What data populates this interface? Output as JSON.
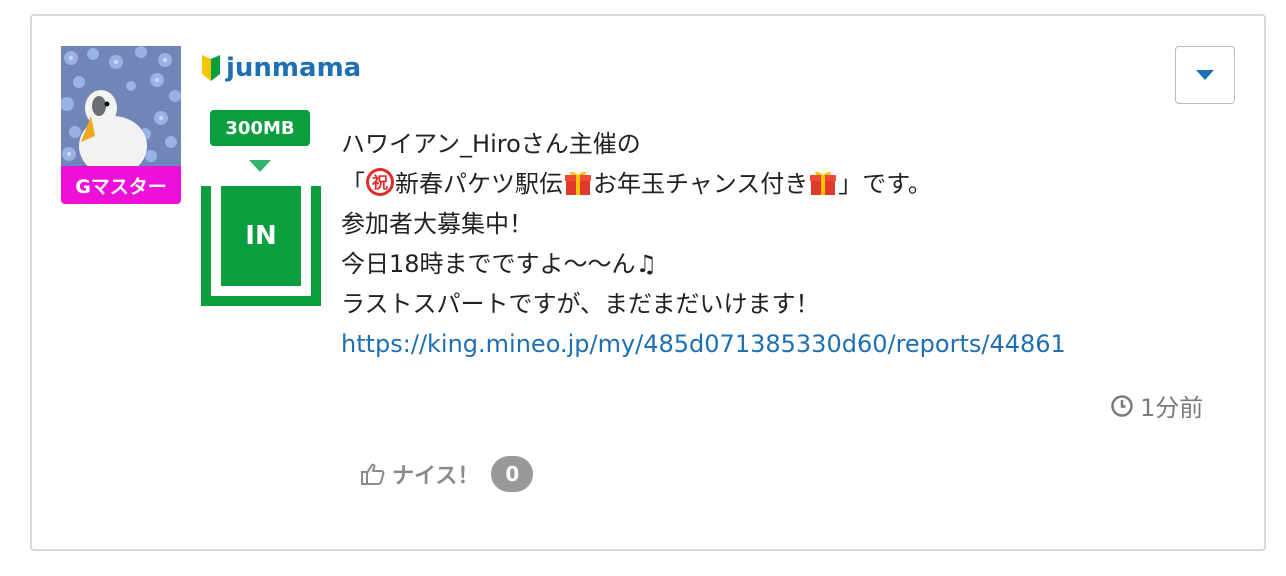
{
  "user": {
    "name": "junmama",
    "rank_badge": "Gマスター"
  },
  "data_badge": {
    "amount": "300MB",
    "direction": "IN"
  },
  "post": {
    "line1": "ハワイアン_Hiroさん主催の",
    "line2_open": "「",
    "line2_a": "新春パケツ駅伝",
    "line2_b": "お年玉チャンス付き",
    "line2_close": "」です。",
    "line3": "参加者大募集中！",
    "line4": "今日18時までですよ〜〜ん♫",
    "line5": "ラストスパートですが、まだまだいけます！",
    "link": "https://king.mineo.jp/my/485d071385330d60/reports/44861"
  },
  "timestamp": "1分前",
  "like": {
    "label": "ナイス！",
    "count": "0"
  },
  "icons": {
    "beginner": "beginner-mark-icon",
    "celebration": "circled-ideograph-congratulation-icon",
    "gift": "gift-icon",
    "clock": "clock-icon",
    "thumb": "thumbs-up-icon",
    "dropdown": "caret-down-icon"
  },
  "colors": {
    "username": "#1f6fb4",
    "rank_badge": "#ee10d8",
    "data_green": "#0a9e3f",
    "link": "#1f6fb4"
  }
}
